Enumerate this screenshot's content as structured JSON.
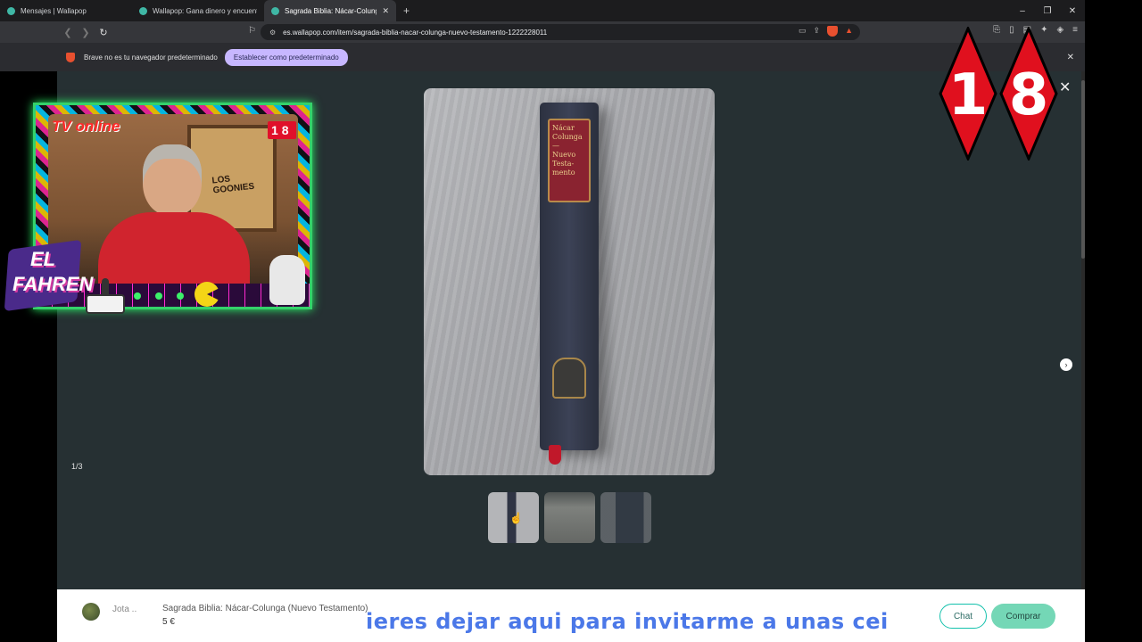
{
  "browser": {
    "tabs": [
      {
        "title": "Mensajes | Wallapop",
        "active": false
      },
      {
        "title": "Wallapop: Gana dinero y encuentra c",
        "active": false
      },
      {
        "title": "Sagrada Biblia: Nácar-Colunga (N",
        "active": true
      }
    ],
    "new_tab": "+",
    "url": "es.wallapop.com/item/sagrada-biblia-nacar-colunga-nuevo-testamento-1222228011",
    "window_controls": [
      "–",
      "❐",
      "✕"
    ]
  },
  "infobar": {
    "message": "Brave no es tu navegador predeterminado",
    "button": "Establecer como predeterminado",
    "close": "✕"
  },
  "gallery": {
    "counter": "1/3",
    "close": "✕",
    "next": "›",
    "book_label_lines": [
      "Nácar",
      "Colunga",
      "—",
      "Nuevo",
      "Testa-",
      "mento"
    ],
    "thumbnails": 3,
    "selected_thumbnail": 1
  },
  "bottom": {
    "seller": "Jota ..",
    "title": "Sagrada Biblia: Nácar-Colunga (Nuevo Testamento)",
    "price": "5 €",
    "chat": "Chat",
    "buy": "Comprar",
    "ticker": "ieres dejar aqui para invitarme a unas cei"
  },
  "overlay": {
    "badge": [
      "1",
      "8"
    ],
    "cam_logo": "TV online",
    "cam_mini_badge": "18",
    "poster": "LOS GOONIES",
    "streamer_line1": "EL",
    "streamer_line2": "FAHREN"
  },
  "colors": {
    "accent": "#13c1ac",
    "buy": "#74d7b6",
    "ticker": "#4b78e8",
    "badge": "#e0101e"
  }
}
